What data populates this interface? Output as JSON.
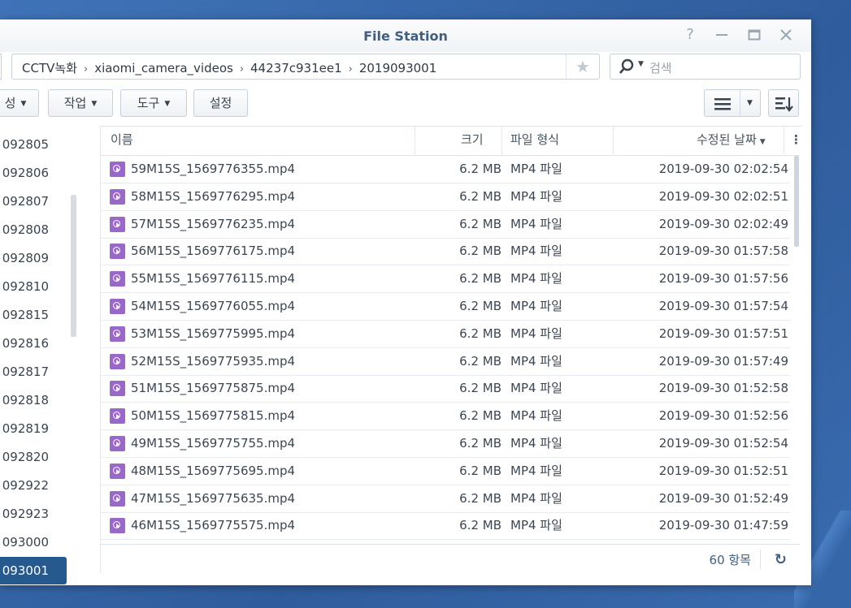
{
  "window": {
    "title": "File Station"
  },
  "path": {
    "crumbs": [
      "CCTV녹화",
      "xiaomi_camera_videos",
      "44237c931ee1",
      "2019093001"
    ],
    "sep": "›"
  },
  "search": {
    "placeholder": "검색"
  },
  "toolbar": {
    "create_label": "성",
    "action_label": "작업",
    "tools_label": "도구",
    "settings_label": "설정"
  },
  "tree": {
    "items": [
      "092805",
      "092806",
      "092807",
      "092808",
      "092809",
      "092810",
      "092815",
      "092816",
      "092817",
      "092818",
      "092819",
      "092820",
      "092922",
      "092923",
      "093000",
      "093001"
    ],
    "selected_index": 15
  },
  "list": {
    "headers": {
      "name": "이름",
      "size": "크기",
      "type": "파일 형식",
      "modified": "수정된 날짜"
    },
    "rows": [
      {
        "name": "59M15S_1569776355.mp4",
        "size": "6.2 MB",
        "type": "MP4 파일",
        "modified": "2019-09-30 02:02:54"
      },
      {
        "name": "58M15S_1569776295.mp4",
        "size": "6.2 MB",
        "type": "MP4 파일",
        "modified": "2019-09-30 02:02:51"
      },
      {
        "name": "57M15S_1569776235.mp4",
        "size": "6.2 MB",
        "type": "MP4 파일",
        "modified": "2019-09-30 02:02:49"
      },
      {
        "name": "56M15S_1569776175.mp4",
        "size": "6.2 MB",
        "type": "MP4 파일",
        "modified": "2019-09-30 01:57:58"
      },
      {
        "name": "55M15S_1569776115.mp4",
        "size": "6.2 MB",
        "type": "MP4 파일",
        "modified": "2019-09-30 01:57:56"
      },
      {
        "name": "54M15S_1569776055.mp4",
        "size": "6.2 MB",
        "type": "MP4 파일",
        "modified": "2019-09-30 01:57:54"
      },
      {
        "name": "53M15S_1569775995.mp4",
        "size": "6.2 MB",
        "type": "MP4 파일",
        "modified": "2019-09-30 01:57:51"
      },
      {
        "name": "52M15S_1569775935.mp4",
        "size": "6.2 MB",
        "type": "MP4 파일",
        "modified": "2019-09-30 01:57:49"
      },
      {
        "name": "51M15S_1569775875.mp4",
        "size": "6.2 MB",
        "type": "MP4 파일",
        "modified": "2019-09-30 01:52:58"
      },
      {
        "name": "50M15S_1569775815.mp4",
        "size": "6.2 MB",
        "type": "MP4 파일",
        "modified": "2019-09-30 01:52:56"
      },
      {
        "name": "49M15S_1569775755.mp4",
        "size": "6.2 MB",
        "type": "MP4 파일",
        "modified": "2019-09-30 01:52:54"
      },
      {
        "name": "48M15S_1569775695.mp4",
        "size": "6.2 MB",
        "type": "MP4 파일",
        "modified": "2019-09-30 01:52:51"
      },
      {
        "name": "47M15S_1569775635.mp4",
        "size": "6.2 MB",
        "type": "MP4 파일",
        "modified": "2019-09-30 01:52:49"
      },
      {
        "name": "46M15S_1569775575.mp4",
        "size": "6.2 MB",
        "type": "MP4 파일",
        "modified": "2019-09-30 01:47:59"
      }
    ]
  },
  "status": {
    "count": "60 항목"
  },
  "colors": {
    "accent": "#3f5e82",
    "selected": "#265a8f",
    "file_icon": "#9a68c9"
  }
}
